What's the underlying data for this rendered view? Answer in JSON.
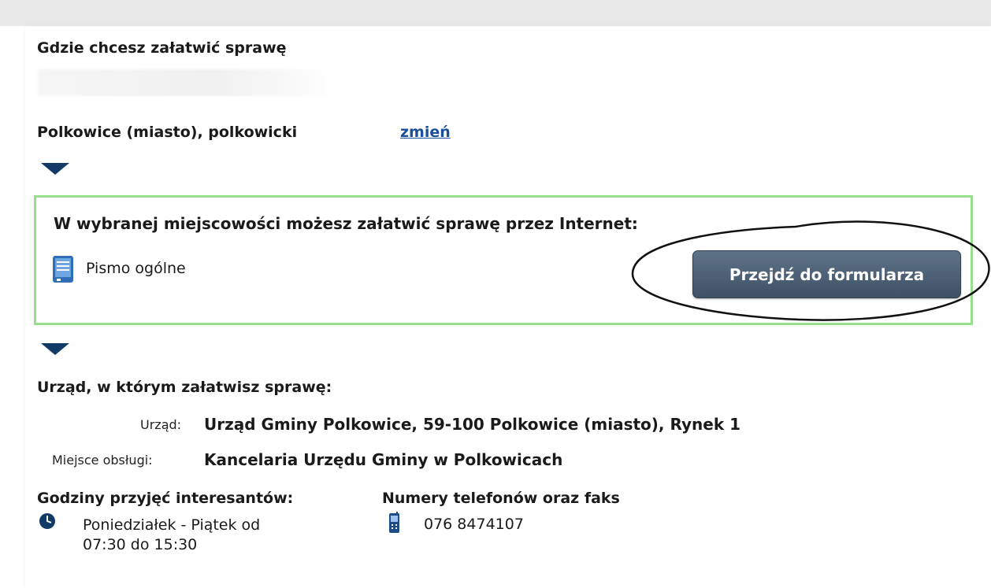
{
  "section": {
    "where_heading": "Gdzie chcesz załatwić sprawę",
    "location": "Polkowice (miasto), polkowicki",
    "change_link": "zmień"
  },
  "online": {
    "title": "W wybranej miejscowości możesz załatwić sprawę przez Internet:",
    "document_label": "Pismo ogólne",
    "document_icon": "document-icon",
    "form_button": "Przejdź do formularza"
  },
  "office": {
    "heading": "Urząd, w którym załatwisz sprawę:",
    "office_label": "Urząd:",
    "office_value": "Urząd Gminy Polkowice, 59-100 Polkowice (miasto), Rynek 1",
    "service_label": "Miejsce obsługi:",
    "service_value": "Kancelaria Urzędu Gminy w Polkowicach"
  },
  "hours": {
    "heading": "Godziny przyjęć interesantów:",
    "text": "Poniedziałek - Piątek  od 07:30 do 15:30",
    "icon": "clock-icon"
  },
  "phones": {
    "heading": "Numery telefonów oraz faks",
    "number": "076 8474107",
    "icon": "phone-icon"
  },
  "colors": {
    "link": "#1a4f9c",
    "green_border": "#98e08e",
    "button_bg": "#4a5d72",
    "arrow": "#123a66"
  }
}
